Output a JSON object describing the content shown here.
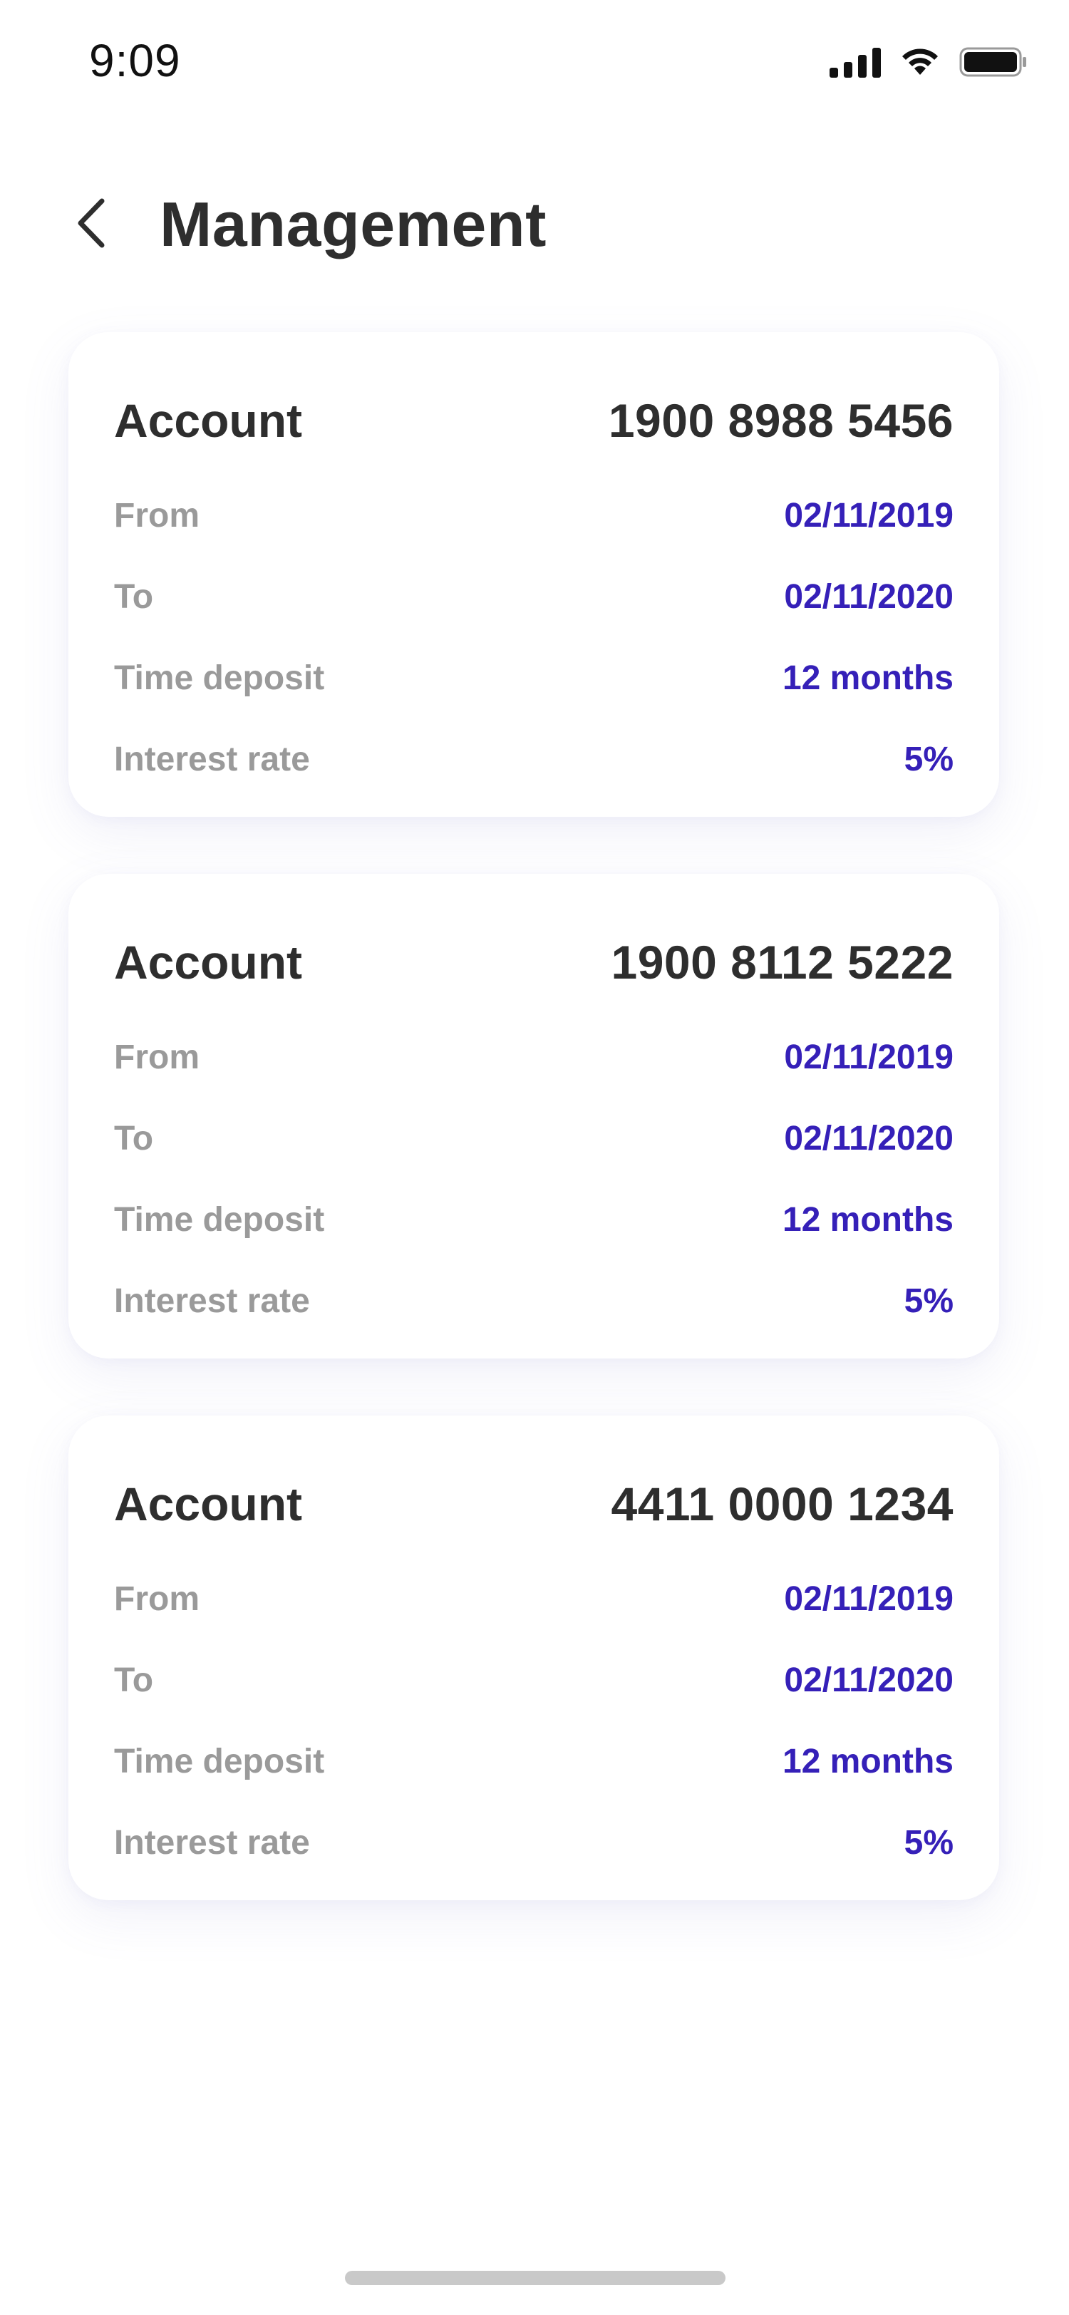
{
  "status_bar": {
    "time": "9:09",
    "icons": [
      "signal-icon",
      "wifi-icon",
      "battery-icon"
    ]
  },
  "header": {
    "back_icon": "chevron-left-icon",
    "title": "Management"
  },
  "colors": {
    "value_accent": "#3520B8",
    "label_gray": "#9A9A9A",
    "title_dark": "#2E2E2E",
    "card_bg": "#FFFFFF"
  },
  "accounts": [
    {
      "label": "Account",
      "number": "1900 8988 5456",
      "rows": [
        {
          "label": "From",
          "value": "02/11/2019"
        },
        {
          "label": "To",
          "value": "02/11/2020"
        },
        {
          "label": "Time deposit",
          "value": "12 months"
        },
        {
          "label": "Interest rate",
          "value": "5%"
        }
      ]
    },
    {
      "label": "Account",
      "number": "1900 8112 5222",
      "rows": [
        {
          "label": "From",
          "value": "02/11/2019"
        },
        {
          "label": "To",
          "value": "02/11/2020"
        },
        {
          "label": "Time deposit",
          "value": "12 months"
        },
        {
          "label": "Interest rate",
          "value": "5%"
        }
      ]
    },
    {
      "label": "Account",
      "number": "4411 0000 1234",
      "rows": [
        {
          "label": "From",
          "value": "02/11/2019"
        },
        {
          "label": "To",
          "value": "02/11/2020"
        },
        {
          "label": "Time deposit",
          "value": "12 months"
        },
        {
          "label": "Interest rate",
          "value": "5%"
        }
      ]
    }
  ]
}
